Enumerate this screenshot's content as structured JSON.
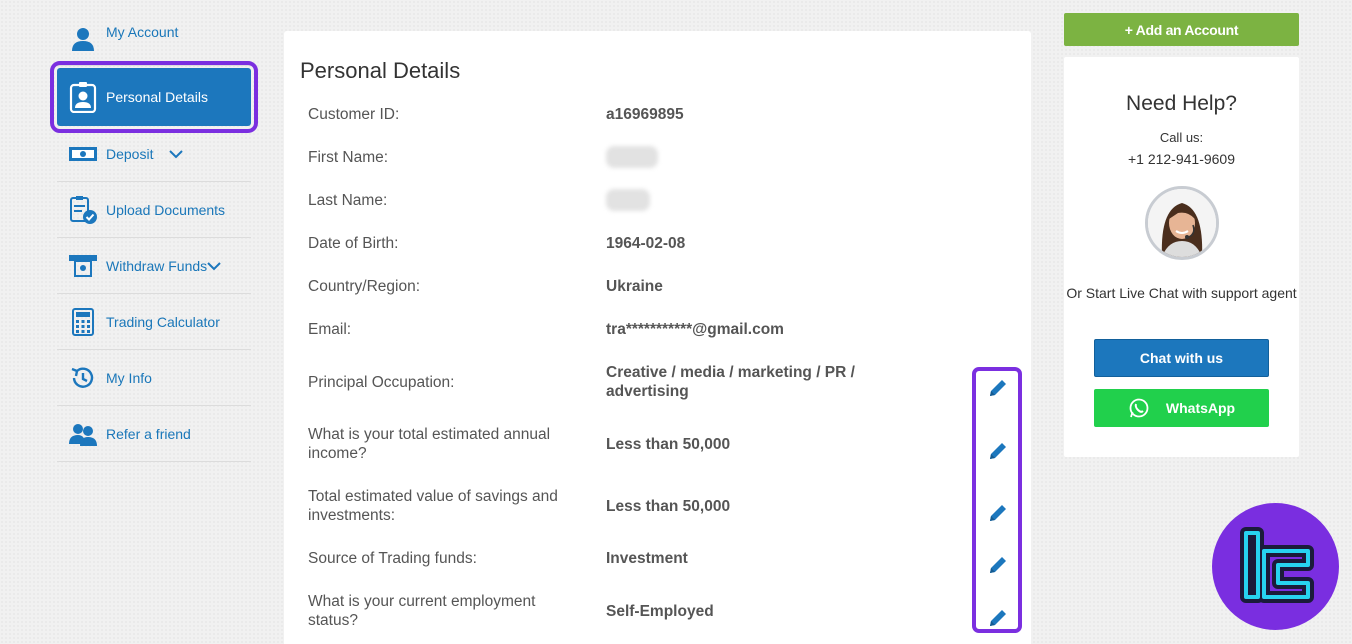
{
  "sidebar": {
    "items": [
      {
        "label": "My Account",
        "icon": "user-icon"
      },
      {
        "label": "Personal Details",
        "icon": "id-badge-icon"
      },
      {
        "label": "Deposit",
        "icon": "banknote-icon"
      },
      {
        "label": "Upload Documents",
        "icon": "document-check-icon"
      },
      {
        "label": "Withdraw Funds",
        "icon": "atm-withdraw-icon"
      },
      {
        "label": "Trading Calculator",
        "icon": "calculator-icon"
      },
      {
        "label": "My Info",
        "icon": "history-icon"
      },
      {
        "label": "Refer a friend",
        "icon": "users-icon"
      }
    ]
  },
  "main": {
    "title": "Personal Details",
    "rows": [
      {
        "label": "Customer ID:",
        "value": "a16969895"
      },
      {
        "label": "First Name:",
        "value": ""
      },
      {
        "label": "Last Name:",
        "value": ""
      },
      {
        "label": "Date of Birth:",
        "value": "1964-02-08"
      },
      {
        "label": "Country/Region:",
        "value": "Ukraine"
      },
      {
        "label": "Email:",
        "value": "tra***********@gmail.com"
      },
      {
        "label": "Principal Occupation:",
        "value": "Creative / media / marketing / PR / advertising"
      },
      {
        "label": "What is your total estimated annual income?",
        "value": "Less than 50,000"
      },
      {
        "label": "Total estimated value of savings and investments:",
        "value": "Less than 50,000"
      },
      {
        "label": "Source of Trading funds:",
        "value": "Investment"
      },
      {
        "label": "What is your current employment status?",
        "value": "Self-Employed"
      }
    ]
  },
  "right": {
    "add_account": "+ Add an Account",
    "help_title": "Need Help?",
    "call_us": "Call us:",
    "phone": "+1 212-941-9609",
    "chat_text": "Or Start Live Chat with support agent",
    "chat_button": "Chat with us",
    "whatsapp_button": "WhatsApp"
  },
  "colors": {
    "accent_blue": "#1c77bd",
    "highlight_purple": "#7b2fe0",
    "green": "#7cb342",
    "whatsapp_green": "#21d04c"
  }
}
